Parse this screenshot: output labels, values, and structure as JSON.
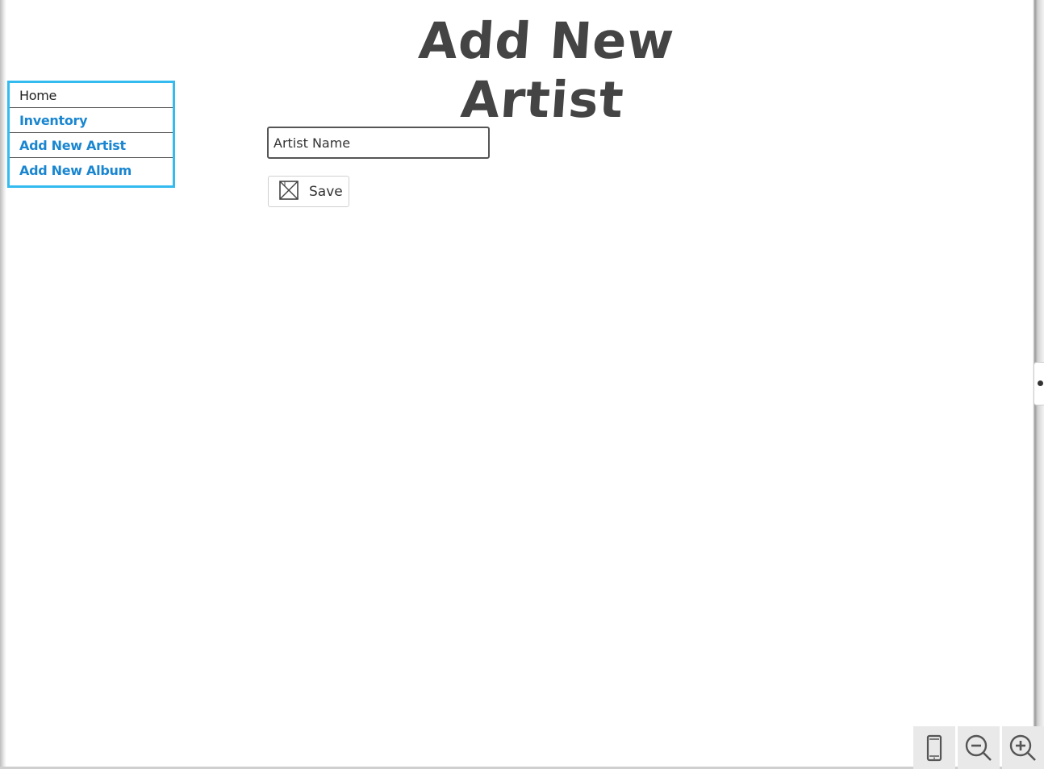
{
  "page": {
    "title": "Add New Artist"
  },
  "nav": {
    "items": [
      {
        "label": "Home",
        "style": "plain"
      },
      {
        "label": "Inventory",
        "style": "link"
      },
      {
        "label": "Add New Artist",
        "style": "link"
      },
      {
        "label": "Add New Album",
        "style": "link"
      }
    ],
    "border_color": "#33bbf0",
    "link_color": "#1a86d0"
  },
  "form": {
    "artist_name": {
      "placeholder": "Artist Name",
      "value": ""
    },
    "save_button": {
      "label": "Save",
      "icon": "image-placeholder-icon"
    }
  },
  "toolbar": {
    "buttons": [
      {
        "name": "device-preview-icon"
      },
      {
        "name": "zoom-out-icon"
      },
      {
        "name": "zoom-in-icon"
      }
    ]
  }
}
